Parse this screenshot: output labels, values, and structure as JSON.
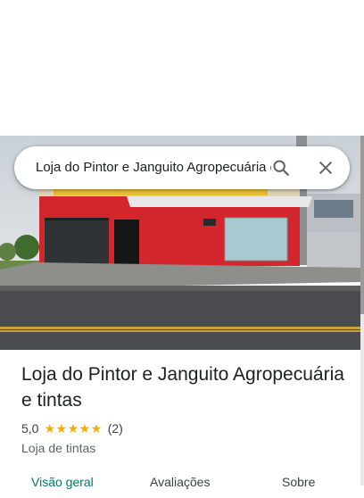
{
  "search": {
    "query": "Loja do Pintor e Janguito Agropecuária e tintas"
  },
  "place": {
    "title": "Loja do Pintor e Janguito Agropecuária e tintas",
    "rating": "5,0",
    "stars": "★★★★★",
    "review_count": "(2)",
    "category": "Loja de tintas"
  },
  "tabs": [
    {
      "label": "Visão geral",
      "active": true
    },
    {
      "label": "Avaliações",
      "active": false
    },
    {
      "label": "Sobre",
      "active": false
    }
  ],
  "icons": {
    "search": "search-icon",
    "close": "close-icon"
  },
  "colors": {
    "accent": "#00796b",
    "star": "#f9ab00",
    "storefront": "#d3262c"
  }
}
